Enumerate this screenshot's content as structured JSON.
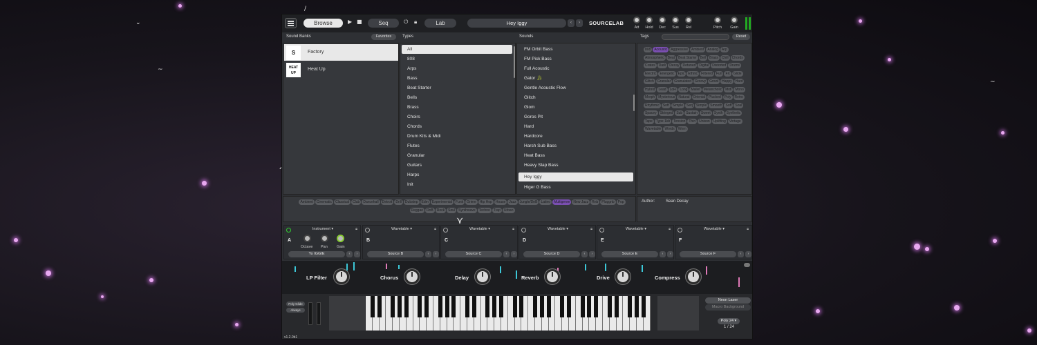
{
  "topbar": {
    "browse": "Browse",
    "seq": "Seq",
    "lab": "Lab",
    "preset_name": "Hey Iggy",
    "brand": "SOURCELAB",
    "knobs": [
      "Att",
      "Hold",
      "Dec",
      "Sus",
      "Rel"
    ],
    "pitch": "Pitch",
    "gain": "Gain"
  },
  "headers": {
    "sound_banks": "Sound Banks",
    "favorites": "Favorites",
    "types": "Types",
    "sounds": "Sounds",
    "tags": "Tags",
    "reset": "Reset"
  },
  "banks": [
    {
      "name": "Factory",
      "logo": "S"
    },
    {
      "name": "Heat Up",
      "logo": "HEAT UP"
    }
  ],
  "types": [
    "All",
    "808",
    "Arps",
    "Bass",
    "Beat Starter",
    "Bells",
    "Brass",
    "Choirs",
    "Chords",
    "Drum Kits & Midi",
    "Flutes",
    "Granular",
    "Guitars",
    "Harps",
    "Init"
  ],
  "sounds": [
    "FM Orbit Bass",
    "FM Pick Bass",
    "Full Acoustic",
    "Gator",
    "Gentle Acoustic Flow",
    "Glitch",
    "Glom",
    "Goros Pit",
    "Hard",
    "Hardcore",
    "Harsh Sub Bass",
    "Heat Bass",
    "Heavy Slap Bass",
    "Hey Iggy",
    "Higer G Bass"
  ],
  "tags": [
    "808",
    "Acoustic",
    "Aggressive",
    "Ambient",
    "Analog",
    "Arp",
    "Atmospheric",
    "Beat",
    "Beat Starter",
    "Bell",
    "Brass",
    "Chill",
    "Chords",
    "Crates",
    "Dark",
    "Decay",
    "Detuned",
    "Digital",
    "Distorted",
    "Drums",
    "Electric",
    "Energetic",
    "Epic",
    "Ethnic",
    "Filtered",
    "Fun",
    "FX",
    "Glide",
    "Glitch",
    "Granular",
    "Granulated",
    "Groovy",
    "Growl",
    "Happy",
    "Hard",
    "Hybrid",
    "Lead",
    "LoFi",
    "Long",
    "Mallet",
    "Melancholic",
    "Midi",
    "Mono",
    "Morph",
    "Mysterious",
    "Natural",
    "Oriental",
    "Plucked",
    "Poly",
    "Retro",
    "Rhythmic",
    "Soft",
    "Simple",
    "Seq",
    "Simple",
    "Smooth",
    "Soft",
    "Soul",
    "Spacey",
    "Stringed",
    "Sub",
    "Sustain",
    "Sweet",
    "Synth",
    "Synthetic",
    "Tape",
    "Type 1kb",
    "Tension",
    "Thin",
    "Unison",
    "Uplifting",
    "Vintage",
    "Wavetable",
    "Words",
    "Worn"
  ],
  "genres": [
    "Ambient",
    "Cinematic",
    "Classical",
    "Club",
    "Dancehall",
    "Detroit",
    "Drill",
    "Dubstep",
    "Edm",
    "Experimental",
    "Funk",
    "Grime",
    "Hip Hop",
    "House",
    "Jazz",
    "Jungle/DnB",
    "Latino",
    "Multigenre",
    "New Jazz",
    "Rnb",
    "Pluggnb",
    "Pop",
    "Reggae",
    "RnB",
    "Rock",
    "Soul",
    "Synthwave",
    "Techno",
    "Trap",
    "Urban"
  ],
  "author_label": "Author:",
  "author": "Sean Decay",
  "sources": [
    {
      "type": "Instrument",
      "letter": "A",
      "name": "Yo IGGIE"
    },
    {
      "type": "Wavetable",
      "letter": "B",
      "name": "Source B"
    },
    {
      "type": "Wavetable",
      "letter": "C",
      "name": "Source C"
    },
    {
      "type": "Wavetable",
      "letter": "D",
      "name": "Source D"
    },
    {
      "type": "Wavetable",
      "letter": "E",
      "name": "Source E"
    },
    {
      "type": "Wavetable",
      "letter": "F",
      "name": "Source F"
    }
  ],
  "source_a_knobs": [
    "Octave",
    "Pan",
    "Gain"
  ],
  "macros": [
    "LP Filter",
    "Chorus",
    "Delay",
    "Reverb",
    "Drive",
    "Compress"
  ],
  "keyboard": {
    "poly_glide": "Poly Glide",
    "always": "Always",
    "neon_laser": "Neon Laser",
    "macro_bg": "Macro Background",
    "poly": "Poly 24",
    "voices": "1 / 24",
    "version": "v1.2.0b1"
  },
  "colors": {
    "accent": "#7a4fb0",
    "bg": "#2e3034",
    "cyan": "#3cc8d8",
    "pink": "#e07ab8"
  }
}
